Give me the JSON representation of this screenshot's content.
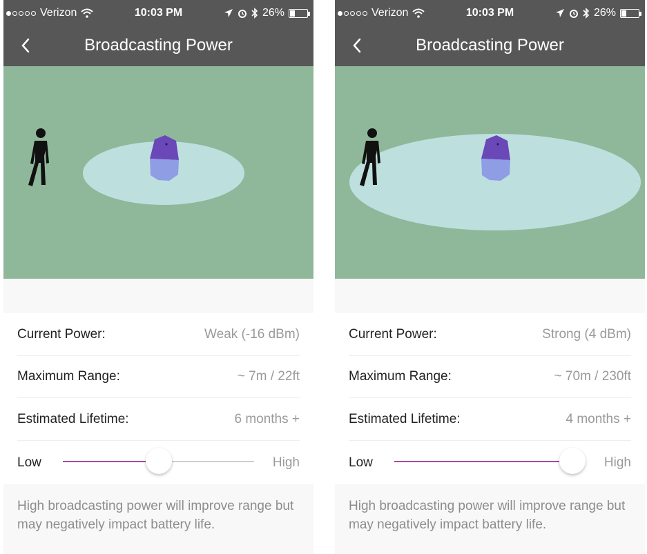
{
  "screens": [
    {
      "statusbar": {
        "carrier": "Verizon",
        "time": "10:03 PM",
        "battery": "26%"
      },
      "nav": {
        "title": "Broadcasting Power"
      },
      "rows": [
        {
          "label": "Current Power:",
          "value": "Weak (-16 dBm)"
        },
        {
          "label": "Maximum Range:",
          "value": "~ 7m / 22ft"
        },
        {
          "label": "Estimated Lifetime:",
          "value": "6 months +"
        }
      ],
      "slider": {
        "low_label": "Low",
        "high_label": "High",
        "level": 0.5
      },
      "note": "High broadcasting power will improve range but may negatively impact battery life."
    },
    {
      "statusbar": {
        "carrier": "Verizon",
        "time": "10:03 PM",
        "battery": "26%"
      },
      "nav": {
        "title": "Broadcasting Power"
      },
      "rows": [
        {
          "label": "Current Power:",
          "value": "Strong (4 dBm)"
        },
        {
          "label": "Maximum Range:",
          "value": "~ 70m / 230ft"
        },
        {
          "label": "Estimated Lifetime:",
          "value": "4 months +"
        }
      ],
      "slider": {
        "low_label": "Low",
        "high_label": "High",
        "level": 0.93
      },
      "note": "High broadcasting power will improve range but may negatively impact battery life."
    }
  ],
  "colors": {
    "bars": "#575757",
    "visual_bg": "#8fb89b",
    "range_fill": "#bde0df",
    "slider_active": "#a54aa3",
    "beacon_top": "#6a48b8",
    "beacon_bottom": "#8f9de4"
  },
  "icons": [
    "signal-dots-icon",
    "wifi-icon",
    "location-arrow-icon",
    "alarm-icon",
    "bluetooth-icon",
    "battery-icon",
    "back-chevron-icon",
    "person-icon",
    "beacon-icon"
  ]
}
